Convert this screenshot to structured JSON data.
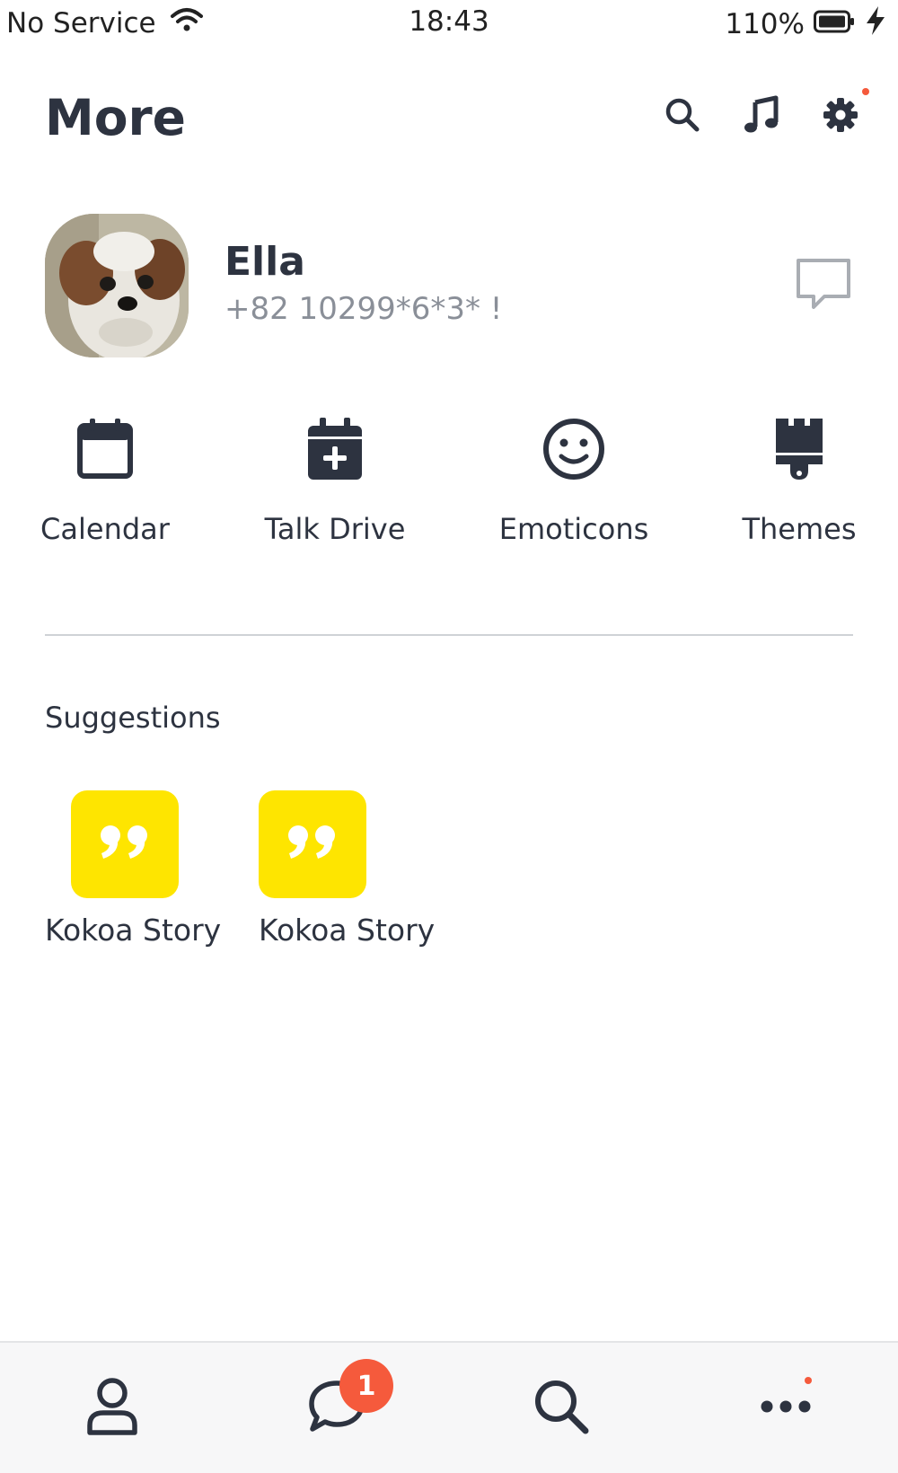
{
  "status_bar": {
    "carrier": "No Service",
    "time": "18:43",
    "battery": "110%"
  },
  "header": {
    "title": "More",
    "icons": [
      "search-icon",
      "music-note-icon",
      "gear-icon"
    ]
  },
  "profile": {
    "name": "Ella",
    "phone": "+82 10299*6*3* !"
  },
  "shortcuts": [
    {
      "label": "Calendar",
      "icon": "calendar-icon"
    },
    {
      "label": "Talk Drive",
      "icon": "calendar-plus-icon"
    },
    {
      "label": "Emoticons",
      "icon": "smiley-icon"
    },
    {
      "label": "Themes",
      "icon": "brush-icon"
    }
  ],
  "suggestions": {
    "title": "Suggestions",
    "items": [
      {
        "label": "Kokoa Story",
        "icon": "quote-icon"
      },
      {
        "label": "Kokoa Story",
        "icon": "quote-icon"
      }
    ]
  },
  "bottom_nav": {
    "items": [
      {
        "icon": "person-icon"
      },
      {
        "icon": "chat-bubble-icon",
        "badge": "1"
      },
      {
        "icon": "search-icon"
      },
      {
        "icon": "more-dots-icon"
      }
    ]
  },
  "colors": {
    "accent_yellow": "#fee500",
    "badge_red": "#f55a3c",
    "text_dark": "#2d3340",
    "text_muted": "#8a8f98"
  }
}
